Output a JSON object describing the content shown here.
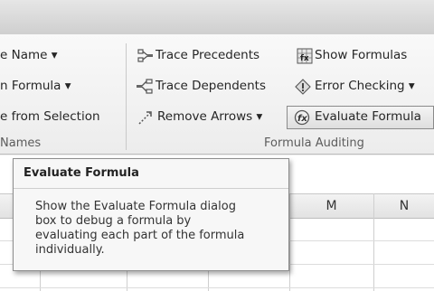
{
  "ribbon": {
    "defined_names": {
      "items": [
        "e Name ▾",
        "n Formula ▾",
        "e from Selection"
      ],
      "group_label": "Names"
    },
    "formula_auditing": {
      "trace_precedents": "Trace Precedents",
      "trace_dependents": "Trace Dependents",
      "remove_arrows": "Remove Arrows ▾",
      "show_formulas": "Show Formulas",
      "error_checking": "Error Checking ▾",
      "evaluate_formula": "Evaluate Formula",
      "group_label": "Formula Auditing"
    }
  },
  "sheet": {
    "columns": [
      "M",
      "N"
    ]
  },
  "tooltip": {
    "title": "Evaluate Formula",
    "body_lines": [
      "Show the Evaluate Formula dialog",
      "box to debug a formula by",
      "evaluating each part of the formula",
      "individually."
    ]
  }
}
